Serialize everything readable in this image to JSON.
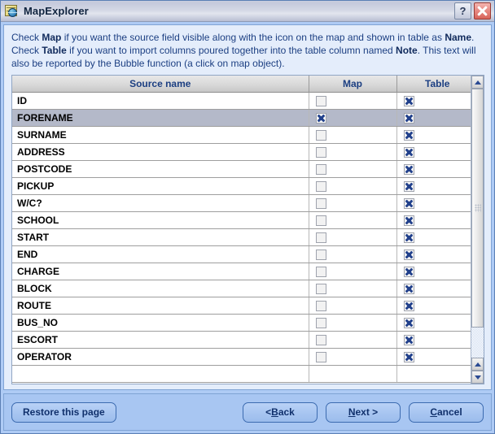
{
  "window": {
    "title": "MapExplorer",
    "icon": "map-globe-icon",
    "help_button_label": "?",
    "close_button_label": "×",
    "accent_color": "#1c3f82",
    "selection_color": "#b4b9c9",
    "panel_color": "#e4edfb",
    "frame_color": "#aecbf5"
  },
  "instructions": {
    "line1_a": "Check ",
    "line1_bold1": "Map",
    "line1_b": " if you want the source field visible along with the icon on the map and shown in table as ",
    "line1_bold2": "Name",
    "line1_c": ".",
    "line2_a": "Check ",
    "line2_bold1": "Table",
    "line2_b": " if you want to import columns poured together into the table column named ",
    "line2_bold2": "Note",
    "line2_c": ". This text will also be reported by the Bubble function (a click on map object)."
  },
  "table": {
    "columns": [
      "Source name",
      "Map",
      "Table"
    ],
    "rows": [
      {
        "name": "ID",
        "map": false,
        "table": true,
        "selected": false
      },
      {
        "name": "FORENAME",
        "map": true,
        "table": true,
        "selected": true
      },
      {
        "name": "SURNAME",
        "map": false,
        "table": true,
        "selected": false
      },
      {
        "name": "ADDRESS",
        "map": false,
        "table": true,
        "selected": false
      },
      {
        "name": "POSTCODE",
        "map": false,
        "table": true,
        "selected": false
      },
      {
        "name": "PICKUP",
        "map": false,
        "table": true,
        "selected": false
      },
      {
        "name": "W/C?",
        "map": false,
        "table": true,
        "selected": false
      },
      {
        "name": "SCHOOL",
        "map": false,
        "table": true,
        "selected": false
      },
      {
        "name": "START",
        "map": false,
        "table": true,
        "selected": false
      },
      {
        "name": "END",
        "map": false,
        "table": true,
        "selected": false
      },
      {
        "name": "CHARGE",
        "map": false,
        "table": true,
        "selected": false
      },
      {
        "name": "BLOCK",
        "map": false,
        "table": true,
        "selected": false
      },
      {
        "name": "ROUTE",
        "map": false,
        "table": true,
        "selected": false
      },
      {
        "name": "BUS_NO",
        "map": false,
        "table": true,
        "selected": false
      },
      {
        "name": "ESCORT",
        "map": false,
        "table": true,
        "selected": false
      },
      {
        "name": "OPERATOR",
        "map": false,
        "table": true,
        "selected": false
      },
      {
        "name": "",
        "map": false,
        "table": false,
        "selected": false
      }
    ]
  },
  "scrollbar": {
    "top_arrow": "scroll-up-arrow",
    "bottom_arrow_up": "scroll-up-arrow",
    "bottom_arrow_down": "scroll-down-arrow",
    "thumb": "scroll-thumb"
  },
  "buttons": {
    "restore": "Restore this page",
    "back_prefix": "< ",
    "back_mnemonic": "B",
    "back_suffix": "ack",
    "next_mnemonic": "N",
    "next_suffix": "ext >",
    "cancel_mnemonic": "C",
    "cancel_suffix": "ancel"
  }
}
